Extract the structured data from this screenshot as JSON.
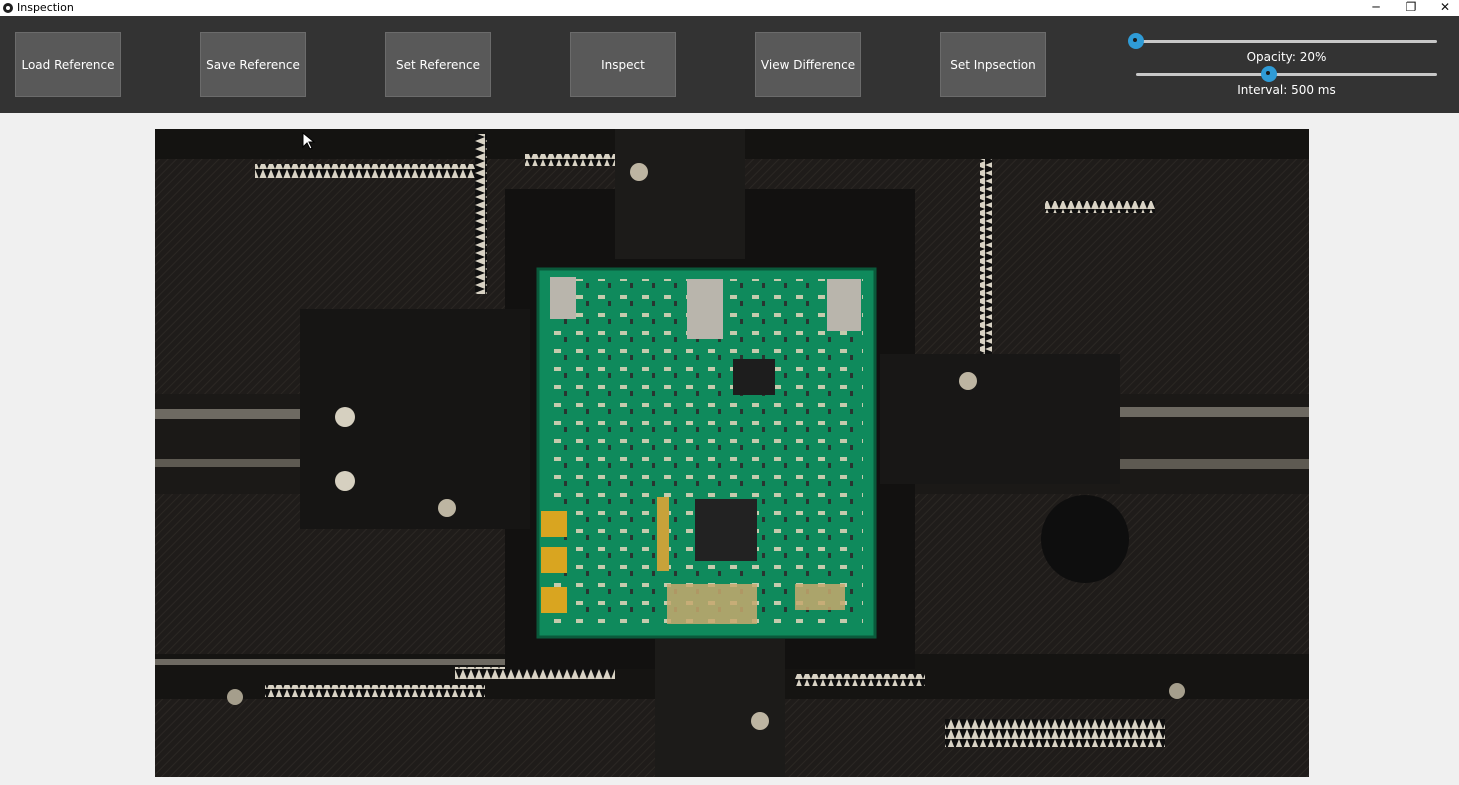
{
  "window": {
    "title": "Inspection",
    "controls": {
      "minimize": "─",
      "maximize": "❐",
      "close": "✕"
    }
  },
  "toolbar": {
    "buttons": [
      {
        "label": "Load Reference"
      },
      {
        "label": "Save Reference"
      },
      {
        "label": "Set Reference"
      },
      {
        "label": "Inspect"
      },
      {
        "label": "View Difference"
      },
      {
        "label": "Set Inpsection"
      }
    ],
    "opacity": {
      "label": "Opacity: 20%",
      "value_percent": 20
    },
    "interval": {
      "label": "Interval: 500 ms",
      "value_ms": 500
    }
  },
  "colors": {
    "toolbar_bg": "#333333",
    "button_bg": "#595959",
    "slider_accent": "#2f9bd6",
    "pcb_green": "#0f8a5c"
  },
  "viewer": {
    "image_description_icon": "camera-feed-image"
  }
}
